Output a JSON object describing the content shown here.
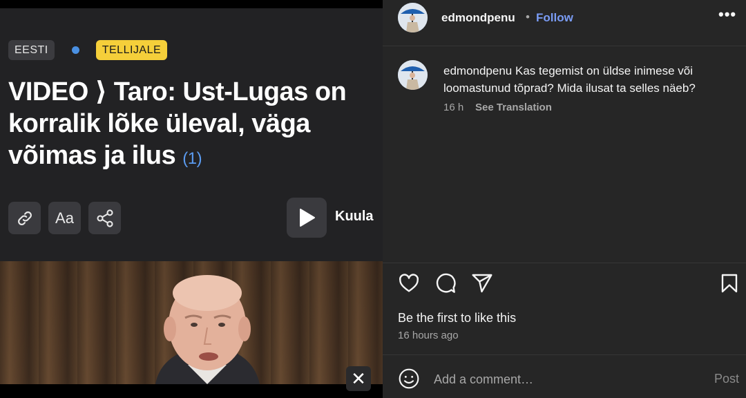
{
  "article": {
    "tag_language": "EESTI",
    "tag_subscriber": "TELLIJALE",
    "headline": "VIDEO ⟩ Taro: Ust-Lugas on korralik lõke üleval, väga võimas ja ilus",
    "comment_count": "(1)",
    "listen_label": "Kuula",
    "icons": [
      "link-icon",
      "font-size-icon",
      "share-icon",
      "play-icon",
      "close-icon"
    ],
    "colors": {
      "accent_blue": "#4a90e2",
      "badge_yellow": "#f5cf3a"
    }
  },
  "instagram": {
    "username": "edmondpenu",
    "bullet": "•",
    "follow_label": "Follow",
    "more_label": "•••",
    "comment": {
      "username": "edmondpenu",
      "text": "Kas tegemist on üldse inimese või loomastunud tõprad? Mida ilusat ta selles näeb?",
      "time": "16 h",
      "translate_label": "See Translation"
    },
    "likes_text": "Be the first to like this",
    "posted_time": "16 hours ago",
    "comment_placeholder": "Add a comment…",
    "post_label": "Post",
    "icons": [
      "heart-icon",
      "comment-icon",
      "send-icon",
      "bookmark-icon",
      "emoji-icon"
    ],
    "colors": {
      "follow_blue": "#7a9cf5",
      "panel_bg": "#262626"
    }
  }
}
